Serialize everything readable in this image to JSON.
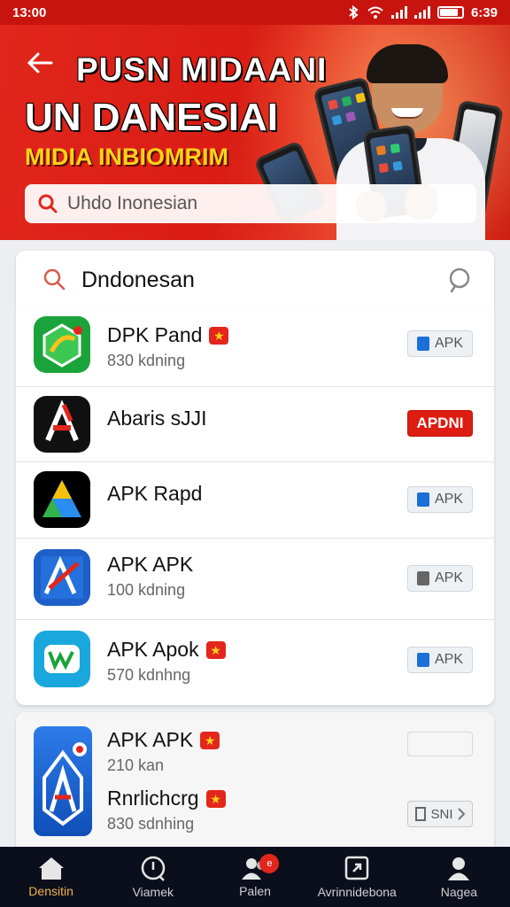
{
  "status_bar": {
    "time_left": "13:00",
    "time_right": "6:39"
  },
  "banner": {
    "headline_line1": "PUSN MIDAANI",
    "headline_line2": "UN DANESIAI",
    "subheadline": "MIDIA INBIOMRIM",
    "search_placeholder": "Uhdo Inonesian"
  },
  "search": {
    "query": "Dndonesan"
  },
  "apps": [
    {
      "name": "DPK Pand",
      "size": "830 kdning",
      "button": "APK",
      "button_style": "blue",
      "badge": true
    },
    {
      "name": "Abaris sJJI",
      "size": "",
      "button": "APDNI",
      "button_style": "red",
      "badge": false
    },
    {
      "name": "APK Rapd",
      "size": "",
      "button": "APK",
      "button_style": "blue",
      "badge": false
    },
    {
      "name": "APK APK",
      "size": "100 kdning",
      "button": "APK",
      "button_style": "grey",
      "badge": false
    },
    {
      "name": "APK Apok",
      "size": "570 kdnhng",
      "button": "APK",
      "button_style": "blue",
      "badge": true
    }
  ],
  "featured": {
    "title": "APK APK",
    "size": "210 kan",
    "second_title": "Rnrlichcrg",
    "second_size": "830 sdnhing",
    "button": "SNI"
  },
  "bottom_nav": [
    {
      "label": "Densitin",
      "icon": "home-icon",
      "active": true
    },
    {
      "label": "Viamek",
      "icon": "explore-icon",
      "active": false
    },
    {
      "label": "Palen",
      "icon": "people-icon",
      "active": false,
      "badge": "e"
    },
    {
      "label": "Avrinnidebona",
      "icon": "external-icon",
      "active": false
    },
    {
      "label": "Nagea",
      "icon": "profile-icon",
      "active": false
    }
  ],
  "colors": {
    "brand_red": "#d91d15",
    "accent_yellow": "#ffd21a",
    "nav_bg": "#0b0f1c"
  }
}
